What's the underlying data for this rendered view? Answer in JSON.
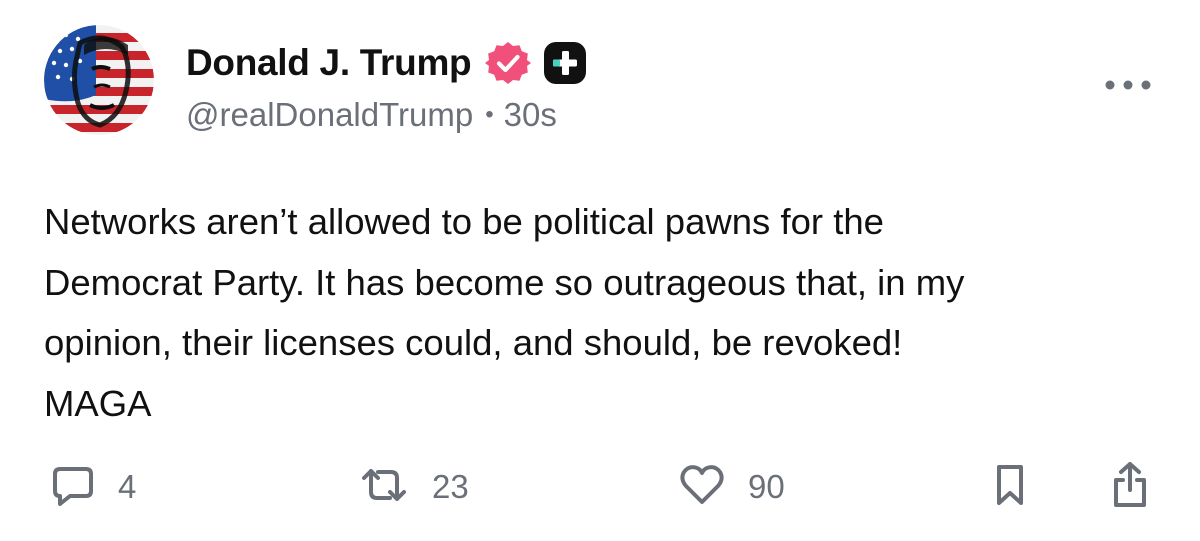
{
  "author": {
    "display_name": "Donald J. Trump",
    "handle": "@realDonaldTrump",
    "time_ago": "30s",
    "separator": "•",
    "avatar_icon": "avatar-flag-portrait-icon",
    "verified_icon": "verified-badge-icon",
    "verified_color": "#f0507a",
    "plus_badge_icon": "plus-badge-icon",
    "plus_badge_accent": "#47d1c2"
  },
  "post": {
    "lines": [
      "Networks aren’t allowed to be political pawns for the",
      "Democrat Party. It has become so outrageous that, in my",
      "opinion, their licenses could, and should, be revoked!",
      "MAGA"
    ]
  },
  "menu": {
    "more_icon": "more-horizontal-icon"
  },
  "actions": {
    "reply": {
      "icon": "comment-icon",
      "count": "4"
    },
    "repost": {
      "icon": "repost-icon",
      "count": "23"
    },
    "like": {
      "icon": "heart-icon",
      "count": "90"
    },
    "bookmark": {
      "icon": "bookmark-icon"
    },
    "share": {
      "icon": "share-icon"
    }
  },
  "colors": {
    "text_primary": "#111111",
    "text_secondary": "#6b6f78",
    "background": "#ffffff"
  }
}
